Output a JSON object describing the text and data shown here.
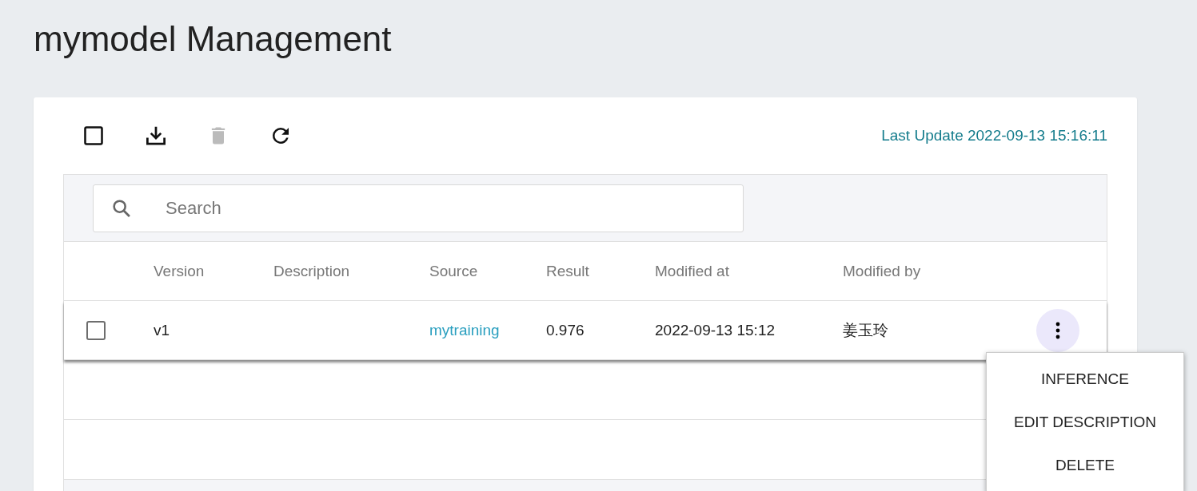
{
  "page": {
    "title": "mymodel Management"
  },
  "toolbar": [
    {
      "kind": "select-all",
      "disabled": false
    },
    {
      "kind": "download",
      "disabled": false
    },
    {
      "kind": "delete",
      "disabled": true
    },
    {
      "kind": "refresh",
      "disabled": false
    }
  ],
  "last_update": "Last Update 2022-09-13 15:16:11",
  "search": {
    "placeholder": "Search"
  },
  "table": {
    "columns": [
      "Version",
      "Description",
      "Source",
      "Result",
      "Modified at",
      "Modified by"
    ],
    "rows": [
      {
        "checked": false,
        "version": "v1",
        "source": "mytraining",
        "result": "0.976",
        "modified_at": "2022-09-13 15:12",
        "modified_by": "姜玉玲",
        "menu_open": true
      }
    ]
  },
  "row_menu": [
    "INFERENCE",
    "EDIT DESCRIPTION",
    "DELETE"
  ]
}
